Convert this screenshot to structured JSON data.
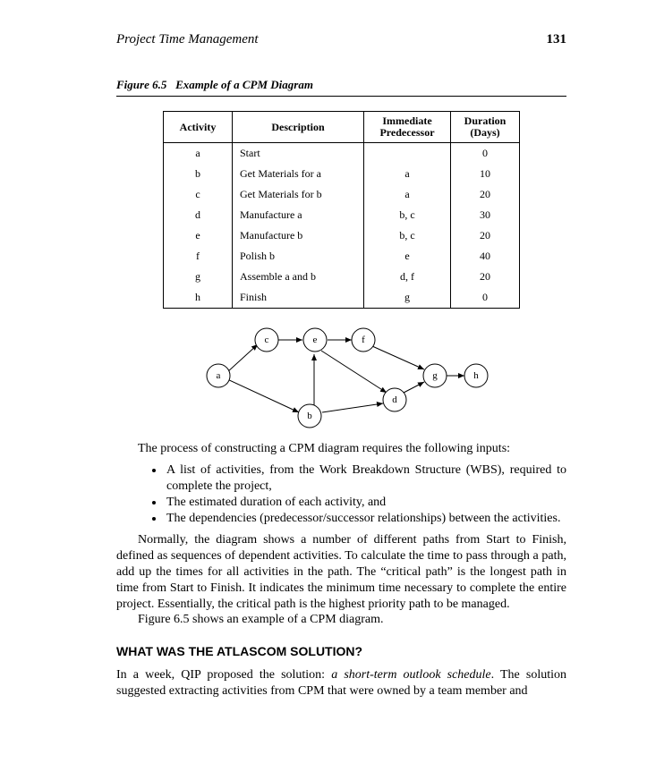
{
  "header": {
    "title": "Project Time Management",
    "page_number": "131"
  },
  "figure": {
    "label": "Figure 6.5",
    "title": "Example of a CPM Diagram"
  },
  "table": {
    "headers": {
      "activity": "Activity",
      "description": "Description",
      "predecessor": "Immediate Predecessor",
      "duration": "Duration (Days)"
    },
    "rows": [
      {
        "act": "a",
        "desc": "Start",
        "pred": "",
        "dur": "0"
      },
      {
        "act": "b",
        "desc": "Get Materials for a",
        "pred": "a",
        "dur": "10"
      },
      {
        "act": "c",
        "desc": "Get Materials for b",
        "pred": "a",
        "dur": "20"
      },
      {
        "act": "d",
        "desc": "Manufacture a",
        "pred": "b, c",
        "dur": "30"
      },
      {
        "act": "e",
        "desc": "Manufacture b",
        "pred": "b, c",
        "dur": "20"
      },
      {
        "act": "f",
        "desc": "Polish b",
        "pred": "e",
        "dur": "40"
      },
      {
        "act": "g",
        "desc": "Assemble a and b",
        "pred": "d, f",
        "dur": "20"
      },
      {
        "act": "h",
        "desc": "Finish",
        "pred": "g",
        "dur": "0"
      }
    ]
  },
  "diagram": {
    "nodes": [
      "a",
      "b",
      "c",
      "d",
      "e",
      "f",
      "g",
      "h"
    ],
    "edges": [
      [
        "a",
        "c"
      ],
      [
        "a",
        "b"
      ],
      [
        "c",
        "e"
      ],
      [
        "b",
        "e"
      ],
      [
        "b",
        "d"
      ],
      [
        "e",
        "f"
      ],
      [
        "e",
        "d"
      ],
      [
        "d",
        "g"
      ],
      [
        "f",
        "g"
      ],
      [
        "g",
        "h"
      ]
    ]
  },
  "text": {
    "p1": "The process of constructing a CPM diagram requires the following inputs:",
    "b1": "A list of activities, from the Work Breakdown Structure (WBS), required to complete the project,",
    "b2": "The estimated duration of each activity, and",
    "b3": "The dependencies (predecessor/successor relationships) between the activities.",
    "p2": "Normally, the diagram shows a number of different paths from Start to Finish, defined as sequences of dependent activities. To calculate the time to pass through a path, add up the times for all activities in the path. The “critical path” is the longest path in time from Start to Finish. It indicates the minimum time necessary to complete the entire project. Essentially, the critical path is the highest priority path to be managed.",
    "p3": "Figure 6.5 shows an example of a CPM diagram.",
    "h2": "WHAT WAS THE ATLASCOM SOLUTION?",
    "p4a": "In a week, QIP proposed the solution: ",
    "p4i": "a short-term outlook schedule",
    "p4b": ". The solution suggested extracting activities from CPM that were owned by a team member and"
  }
}
